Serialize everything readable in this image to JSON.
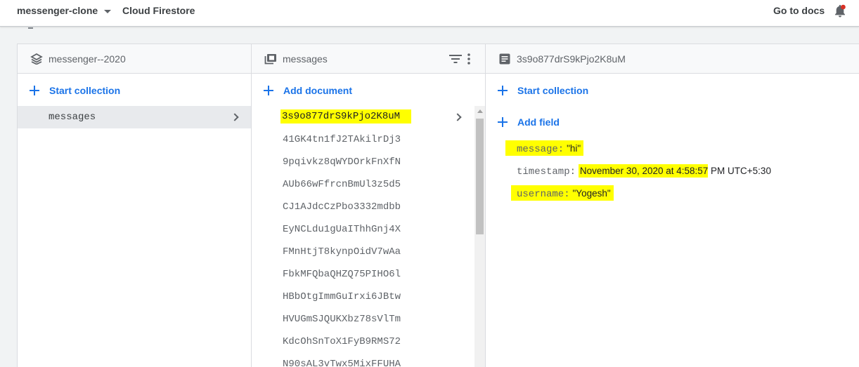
{
  "topbar": {
    "project": "messenger-clone",
    "product": "Cloud Firestore",
    "docs_link": "Go to docs"
  },
  "colors": {
    "accent": "#1a73e8",
    "highlight": "#ffff00",
    "bell": "#1a73e8"
  },
  "root_panel": {
    "title": "messenger--2020",
    "icon": "firestore-database-icon",
    "start_collection_label": "Start collection",
    "collections": [
      "messages"
    ]
  },
  "collection_panel": {
    "title": "messages",
    "icon": "collection-icon",
    "add_document_label": "Add document",
    "documents": [
      "3s9o877drS9kPjo2K8uM",
      "41GK4tn1fJ2TAkilrDj3",
      "9pqivkz8qWYDOrkFnXfN",
      "AUb66wFfrcnBmUl3z5d5",
      "CJ1AJdcCzPbo3332mdbb",
      "EyNCLdu1gUaIThhGnj4X",
      "FMnHtjT8kynpOidV7wAa",
      "FbkMFQbaQHZQ75PIHO6l",
      "HBbOtgImmGuIrxi6JBtw",
      "HVUGmSJQUKXbz78sVlTm",
      "KdcOhSnToX1FyB9RMS72",
      "N90sAL3vTwx5MixFFUHA"
    ]
  },
  "document_panel": {
    "title": "3s9o877drS9kPjo2K8uM",
    "icon": "document-icon",
    "start_collection_label": "Start collection",
    "add_field_label": "Add field",
    "fields": [
      {
        "key": "message:",
        "value": "\"hi\""
      },
      {
        "key": "timestamp:",
        "value_highlighted": "November 30, 2020 at 4:58:57",
        "value_rest": " PM UTC+5:30"
      },
      {
        "key": "username:",
        "value": "\"Yogesh\""
      }
    ]
  }
}
